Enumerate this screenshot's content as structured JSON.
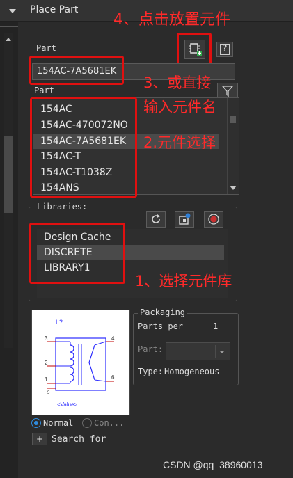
{
  "panel": {
    "title": "Place Part"
  },
  "part_field": {
    "label": "Part",
    "value": "154AC-7A5681EK"
  },
  "part_list": {
    "label": "Part",
    "items": [
      "154AC",
      "154AC-470072NO",
      "154AC-7A5681EK",
      "154AC-T",
      "154AC-T1038Z",
      "154ANS"
    ],
    "selected_index": 2
  },
  "libraries": {
    "label": "Libraries:",
    "items": [
      "Design Cache",
      "DISCRETE",
      "LIBRARY1"
    ],
    "selected_index": 1
  },
  "preview": {
    "ref": "L?",
    "pins": [
      "3",
      "4",
      "2",
      "1",
      "5",
      "6"
    ],
    "value": "<Value>"
  },
  "packaging": {
    "title": "Packaging",
    "parts_per_label": "Parts per",
    "parts_per_value": "1",
    "part_label": "Part:",
    "type_label": "Type:",
    "type_value": "Homogeneous"
  },
  "view_mode": {
    "normal": "Normal",
    "convert": "Con..."
  },
  "search": {
    "expand": "+",
    "label": "Search for"
  },
  "annotations": {
    "place": "4、点击放置元件",
    "type_in_1": "3、或直接",
    "type_in_2": "输入元件名",
    "select_part": "2.元件选择",
    "select_lib": "1、选择元件库"
  },
  "watermark": "CSDN @qq_38960013",
  "colors": {
    "annotation": "#ff2a2a",
    "panel_bg": "#2b2b2b",
    "selection": "#4a4a4a"
  },
  "icons": [
    "collapse-arrow-icon",
    "place-part-icon",
    "help-icon",
    "filter-icon",
    "refresh-icon",
    "add-library-icon",
    "remove-library-icon",
    "scroll-down-icon",
    "dropdown-arrow-icon",
    "expand-icon",
    "radio-icon"
  ]
}
